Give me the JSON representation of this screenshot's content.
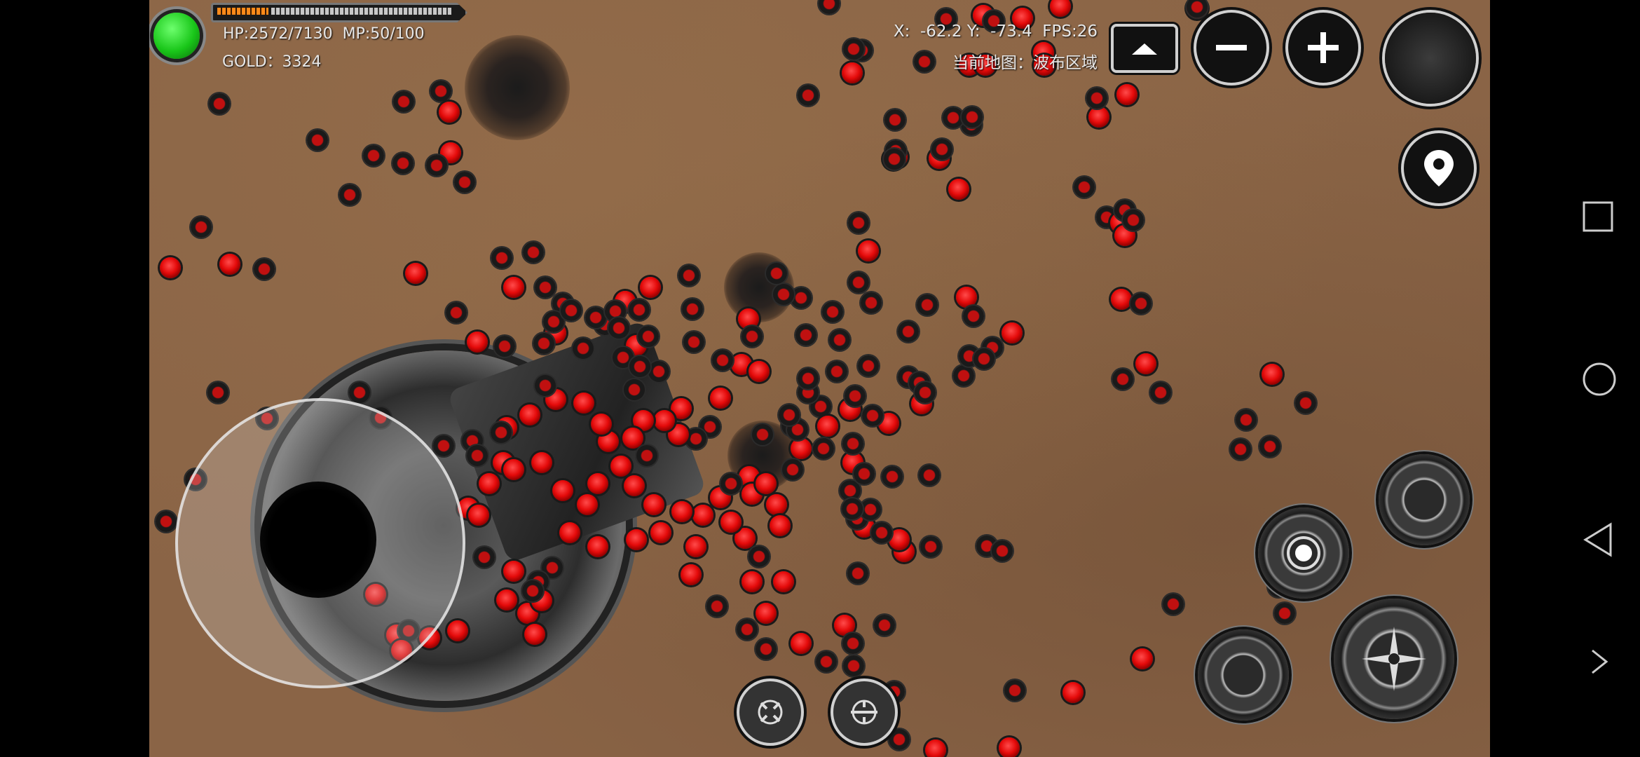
{
  "hud": {
    "hp_mp": "HP:2572/7130  MP:50/100",
    "gold": "GOLD：3324",
    "coords": "X:  -62.2 Y:  -73.4  FPS:26",
    "current_map": "当前地图：波布区域",
    "xp_progress": 0.22
  },
  "buttons": {
    "expand": "expand-up",
    "zoom_out": "minus",
    "zoom_in": "plus",
    "map_marker": "location-pin",
    "skill_1": "skill-gear-1",
    "skill_2": "skill-gear-2",
    "skill_3": "skill-gear-3",
    "attack": "attack-crosshair",
    "bottom_1": "target-lock",
    "bottom_2": "swap-target"
  },
  "android_nav": [
    "recents",
    "home",
    "back",
    "expand-right"
  ]
}
